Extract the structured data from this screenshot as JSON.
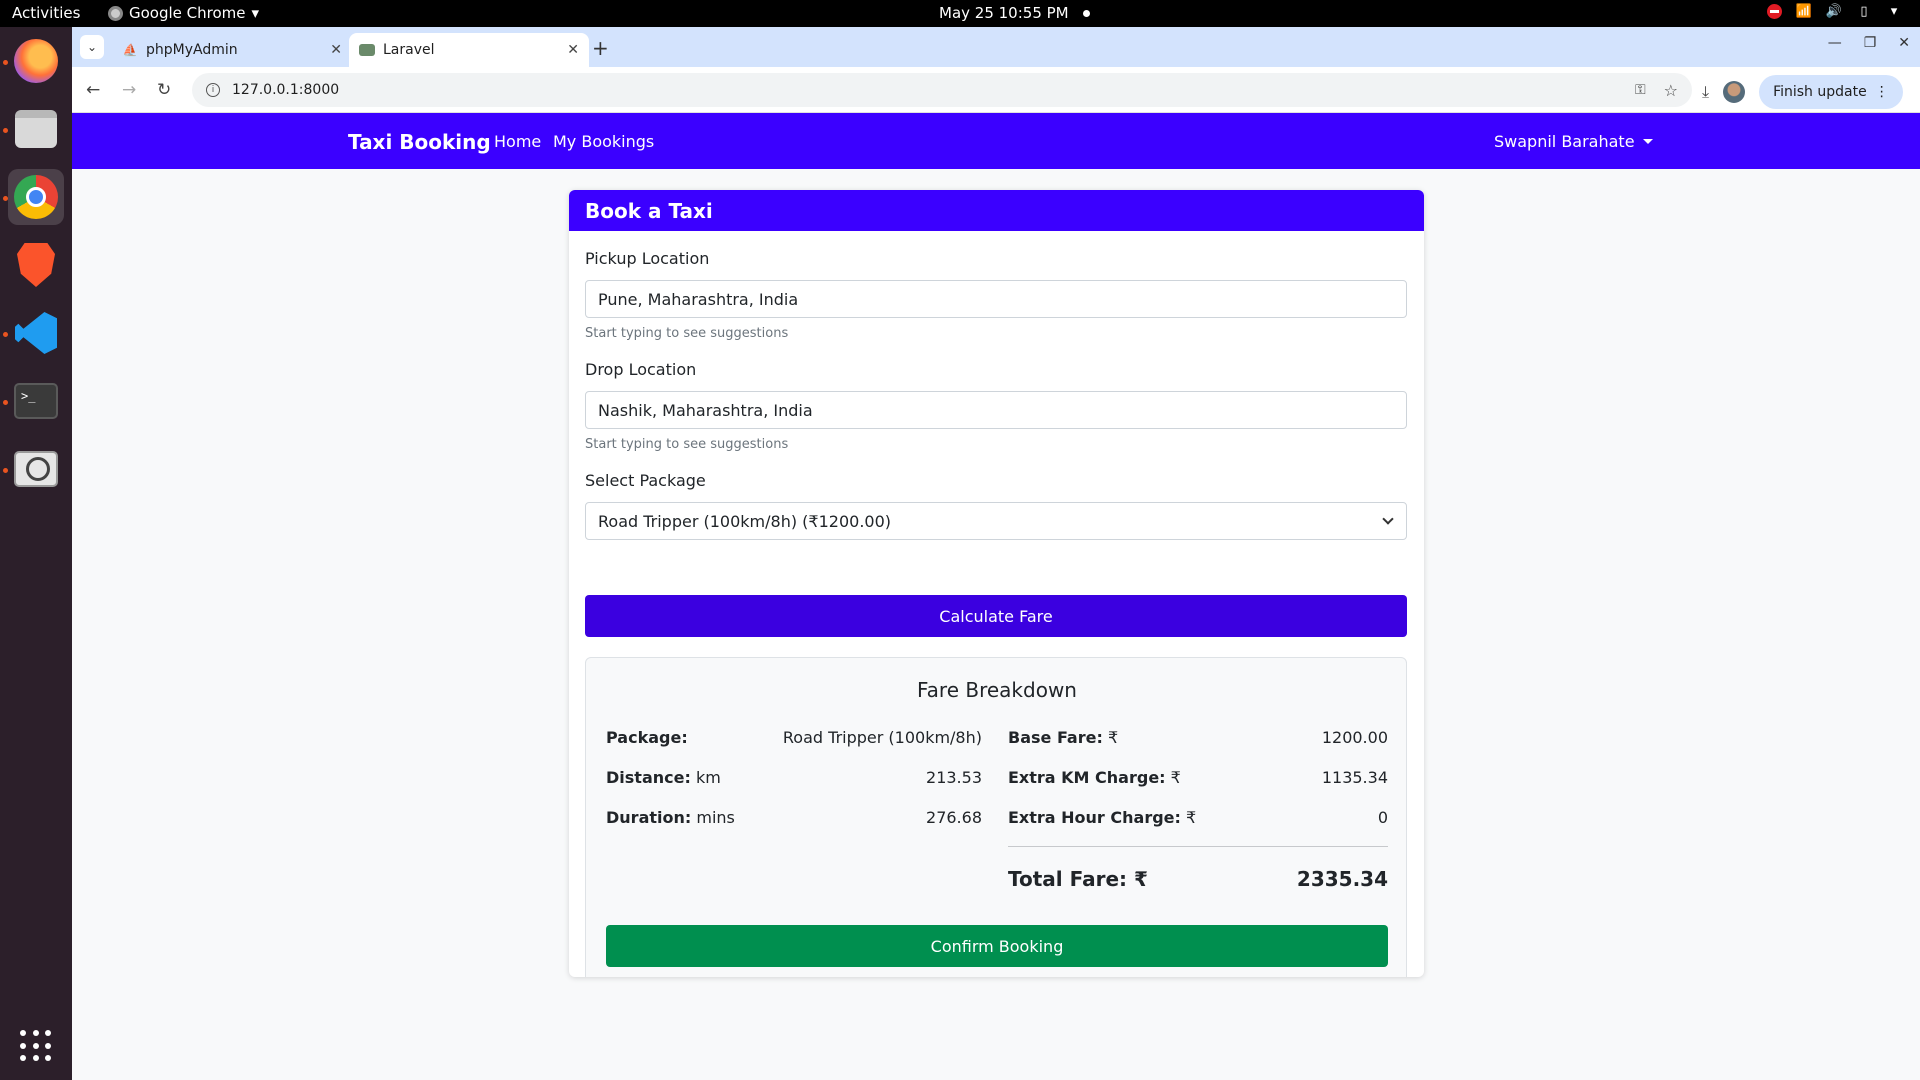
{
  "system": {
    "activities": "Activities",
    "app_name": "Google Chrome",
    "clock": "May 25  10:55 PM"
  },
  "browser": {
    "tabs": [
      {
        "label": "phpMyAdmin",
        "active": false
      },
      {
        "label": "Laravel",
        "active": true
      }
    ],
    "url": "127.0.0.1:8000",
    "finish_update": "Finish update"
  },
  "navbar": {
    "brand": "Taxi Booking",
    "links": [
      "Home",
      "My Bookings"
    ],
    "user": "Swapnil Barahate",
    "color": "#3b00ff"
  },
  "form": {
    "title": "Book a Taxi",
    "pickup_label": "Pickup Location",
    "pickup_value": "Pune, Maharashtra, India",
    "pickup_help": "Start typing to see suggestions",
    "drop_label": "Drop Location",
    "drop_value": "Nashik, Maharashtra, India",
    "drop_help": "Start typing to see suggestions",
    "package_label": "Select Package",
    "package_value": "Road Tripper (100km/8h) (₹1200.00)",
    "calculate_label": "Calculate Fare"
  },
  "breakdown": {
    "title": "Fare Breakdown",
    "left": [
      {
        "label": "Package:",
        "unit": "",
        "value": "Road Tripper (100km/8h)"
      },
      {
        "label": "Distance:",
        "unit": " km",
        "value": "213.53"
      },
      {
        "label": "Duration:",
        "unit": " mins",
        "value": "276.68"
      }
    ],
    "right": [
      {
        "label": "Base Fare:",
        "unit": " ₹",
        "value": "1200.00"
      },
      {
        "label": "Extra KM Charge:",
        "unit": " ₹",
        "value": "1135.34"
      },
      {
        "label": "Extra Hour Charge:",
        "unit": " ₹",
        "value": "0"
      }
    ],
    "total_label": "Total Fare: ₹",
    "total_value": "2335.34",
    "confirm_label": "Confirm Booking"
  }
}
